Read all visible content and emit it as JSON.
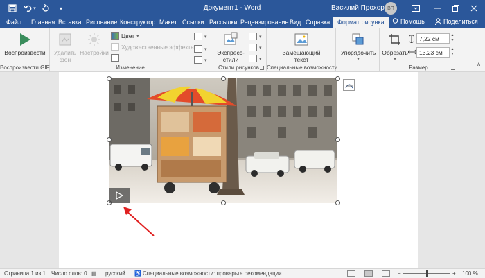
{
  "titlebar": {
    "title": "Документ1 - Word",
    "user_name": "Василий Прохоров",
    "avatar_initials": "ВП",
    "save_icon": "save-icon",
    "undo_icon": "undo-icon",
    "redo_icon": "redo-icon",
    "customize_icon": "customize-qat-icon",
    "ribbon_display_icon": "ribbon-display-options-icon",
    "minimize_icon": "minimize-icon",
    "restore_icon": "restore-icon",
    "close_icon": "close-icon",
    "accent": "#2b579a"
  },
  "tabs": {
    "file": "Файл",
    "home": "Главная",
    "insert": "Вставка",
    "draw": "Рисование",
    "design": "Конструктор",
    "layout": "Макет",
    "references": "Ссылки",
    "mailings": "Рассылки",
    "review": "Рецензирование",
    "view": "Вид",
    "help": "Справка",
    "picture_format": "Формат рисунка",
    "tell_me": "Помощь",
    "share": "Поделиться"
  },
  "ribbon": {
    "gif_group": {
      "play_label": "Воспроизвести",
      "group_label": "Воспроизвести GIF"
    },
    "adjust_group": {
      "remove_bg_label": "Удалить фон",
      "settings_label": "Настройки",
      "color_label": "Цвет",
      "artistic_label": "Художественные эффекты",
      "group_label": "Изменение"
    },
    "styles_group": {
      "express_label": "Экспресс-стили",
      "group_label": "Стили рисунков"
    },
    "accessibility_group": {
      "alt_text_label": "Замещающий текст",
      "group_label": "Специальные возможности"
    },
    "arrange_group": {
      "arrange_label": "Упорядочить"
    },
    "size_group": {
      "crop_label": "Обрезать",
      "height_value": "7,22 см",
      "width_value": "13,23 см",
      "group_label": "Размер"
    }
  },
  "document": {
    "picture_kind": "animated-gif-street-scene",
    "play_icon": "play-icon",
    "layout_options_icon": "layout-options-icon"
  },
  "statusbar": {
    "page": "Страница 1 из 1",
    "words": "Число слов: 0",
    "language": "русский",
    "accessibility": "Специальные возможности: проверьте рекомендации",
    "zoom_minus": "−",
    "zoom_plus": "+",
    "zoom": "100 %"
  }
}
